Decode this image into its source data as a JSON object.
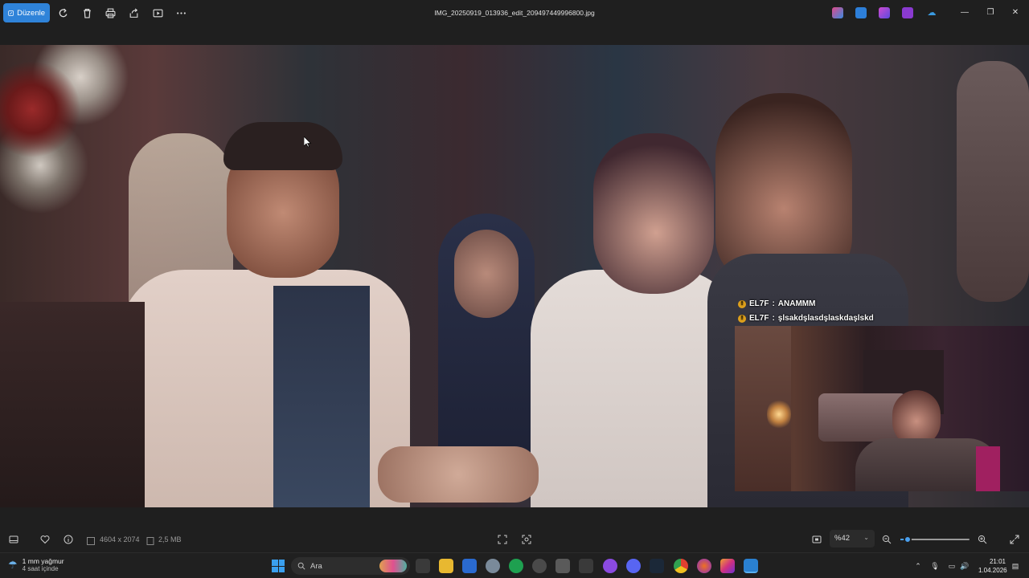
{
  "toolbar": {
    "edit_label": "Düzenle",
    "file_title": "IMG_20250919_013936_edit_2094974499968​00.jpg"
  },
  "photo": {
    "chat": [
      {
        "user": "EL7F",
        "message": "ANAMMM"
      },
      {
        "user": "EL7F",
        "message": "şlsakdşlasdşlaskdaşlskd"
      }
    ]
  },
  "bottombar": {
    "dimensions": "4604 x 2074",
    "file_size": "2,5 MB",
    "zoom": "%42",
    "zoom_fraction": 0.1
  },
  "taskbar": {
    "weather_line1": "1 mm yağmur",
    "weather_line2": "4 saat içinde",
    "search_placeholder": "Ara",
    "time": "21:01",
    "date": "1.04.2026"
  },
  "colors": {
    "accent": "#2f83d9",
    "toolbar_bg": "#1f1f1f",
    "taskbar_bg": "#202020"
  }
}
